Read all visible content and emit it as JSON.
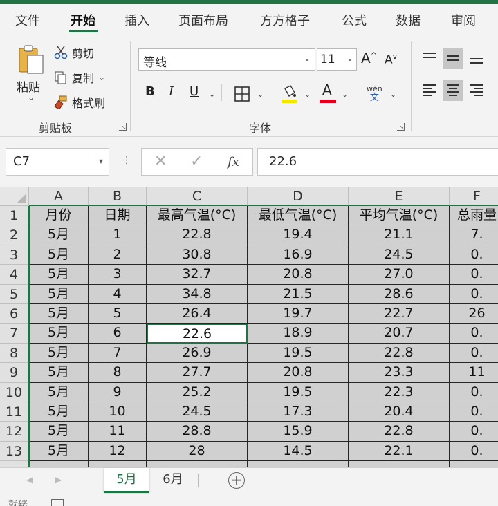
{
  "menu": {
    "tabs": [
      {
        "label": "文件",
        "active": false
      },
      {
        "label": "开始",
        "active": true
      },
      {
        "label": "插入",
        "active": false
      },
      {
        "label": "页面布局",
        "active": false
      },
      {
        "label": "方方格子",
        "active": false
      },
      {
        "label": "公式",
        "active": false
      },
      {
        "label": "数据",
        "active": false
      },
      {
        "label": "审阅",
        "active": false
      }
    ]
  },
  "ribbon": {
    "clipboard": {
      "paste": "粘贴",
      "cut": "剪切",
      "copy": "复制",
      "format_painter": "格式刷",
      "group_label": "剪贴板"
    },
    "font": {
      "font_name": "等线",
      "font_size": "11",
      "bold": "B",
      "italic": "I",
      "underline": "U",
      "phonetic_top": "wén",
      "phonetic_bottom": "文",
      "font_color_letter": "A",
      "group_label": "字体"
    }
  },
  "formula_bar": {
    "name_box": "C7",
    "value": "22.6",
    "fx": "fx"
  },
  "sheet": {
    "columns": [
      "A",
      "B",
      "C",
      "D",
      "E",
      "F"
    ],
    "rows": [
      [
        "月份",
        "日期",
        "最高气温(°C)",
        "最低气温(°C)",
        "平均气温(°C)",
        "总雨量"
      ],
      [
        "5月",
        "1",
        "22.8",
        "19.4",
        "21.1",
        "7."
      ],
      [
        "5月",
        "2",
        "30.8",
        "16.9",
        "24.5",
        "0."
      ],
      [
        "5月",
        "3",
        "32.7",
        "20.8",
        "27.0",
        "0."
      ],
      [
        "5月",
        "4",
        "34.8",
        "21.5",
        "28.6",
        "0."
      ],
      [
        "5月",
        "5",
        "26.4",
        "19.7",
        "22.7",
        "26"
      ],
      [
        "5月",
        "6",
        "22.6",
        "18.9",
        "20.7",
        "0."
      ],
      [
        "5月",
        "7",
        "26.9",
        "19.5",
        "22.8",
        "0."
      ],
      [
        "5月",
        "8",
        "27.7",
        "20.8",
        "23.3",
        "11"
      ],
      [
        "5月",
        "9",
        "25.2",
        "19.5",
        "22.3",
        "0."
      ],
      [
        "5月",
        "10",
        "24.5",
        "17.3",
        "20.4",
        "0."
      ],
      [
        "5月",
        "11",
        "28.8",
        "15.9",
        "22.8",
        "0."
      ],
      [
        "5月",
        "12",
        "28",
        "14.5",
        "22.1",
        "0."
      ]
    ],
    "active_cell": "C7",
    "sheet_tabs": [
      {
        "label": "5月",
        "active": true
      },
      {
        "label": "6月",
        "active": false
      }
    ]
  },
  "status": {
    "text": "就绪"
  },
  "colors": {
    "accent": "#217346",
    "cell_fill": "#d0d0d0"
  }
}
